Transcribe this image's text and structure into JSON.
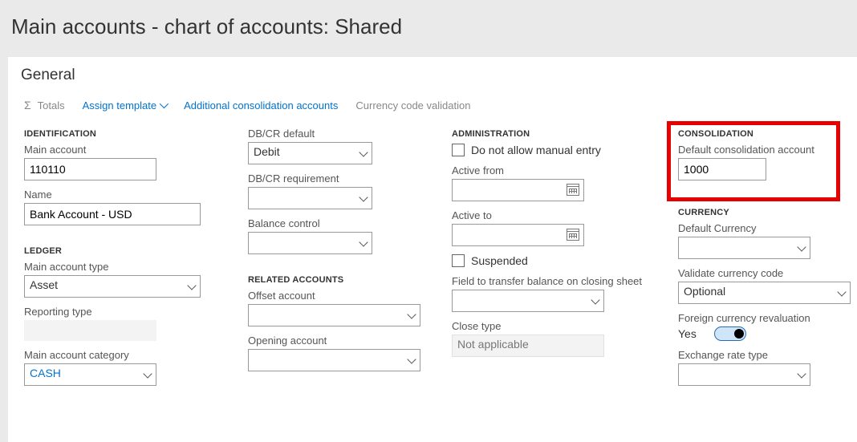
{
  "header": {
    "title": "Main accounts - chart of accounts: Shared"
  },
  "panel": {
    "title": "General"
  },
  "toolbar": {
    "totals": "Totals",
    "assign_template": "Assign template",
    "additional_consolidation": "Additional consolidation accounts",
    "currency_code_validation": "Currency code validation"
  },
  "sections": {
    "identification": "IDENTIFICATION",
    "ledger": "LEDGER",
    "dbcr_default": "DB/CR default",
    "dbcr_requirement": "DB/CR requirement",
    "balance_control": "Balance control",
    "related_accounts": "RELATED ACCOUNTS",
    "administration": "ADMINISTRATION",
    "consolidation": "CONSOLIDATION",
    "currency": "CURRENCY"
  },
  "fields": {
    "main_account_label": "Main account",
    "main_account_value": "110110",
    "name_label": "Name",
    "name_value": "Bank Account - USD",
    "main_account_type_label": "Main account type",
    "main_account_type_value": "Asset",
    "reporting_type_label": "Reporting type",
    "reporting_type_value": "",
    "main_account_category_label": "Main account category",
    "main_account_category_value": "CASH",
    "dbcr_default_value": "Debit",
    "dbcr_requirement_value": "",
    "balance_control_value": "",
    "offset_account_label": "Offset account",
    "offset_account_value": "",
    "opening_account_label": "Opening account",
    "opening_account_value": "",
    "do_not_allow_manual": "Do not allow manual entry",
    "active_from_label": "Active from",
    "active_from_value": "",
    "active_to_label": "Active to",
    "active_to_value": "",
    "suspended_label": "Suspended",
    "transfer_balance_label": "Field to transfer balance on closing sheet",
    "transfer_balance_value": "",
    "close_type_label": "Close type",
    "close_type_value": "Not applicable",
    "default_consolidation_label": "Default consolidation account",
    "default_consolidation_value": "1000",
    "default_currency_label": "Default Currency",
    "default_currency_value": "",
    "validate_currency_label": "Validate currency code",
    "validate_currency_value": "Optional",
    "foreign_currency_label": "Foreign currency revaluation",
    "foreign_currency_value": "Yes",
    "exchange_rate_type_label": "Exchange rate type",
    "exchange_rate_type_value": ""
  }
}
